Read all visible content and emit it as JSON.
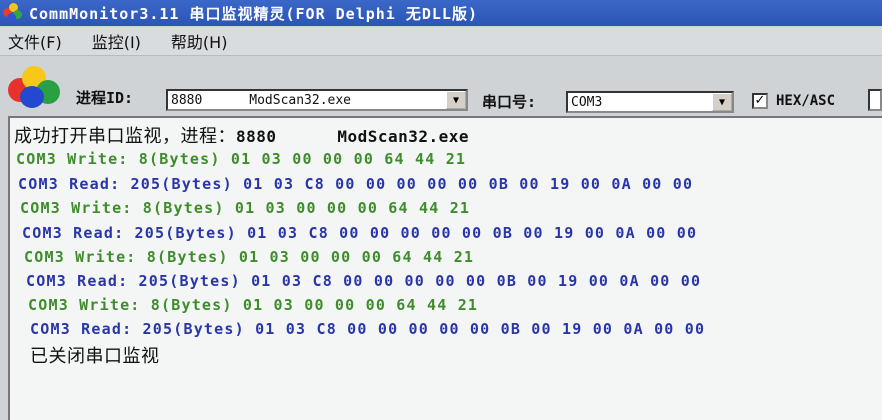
{
  "window": {
    "title": "CommMonitor3.11 串口监视精灵(FOR Delphi 无DLL版)"
  },
  "menu": [
    {
      "label": "文件(F)"
    },
    {
      "label": "监控(I)"
    },
    {
      "label": "帮助(H)"
    }
  ],
  "toolbar": {
    "process_label": "进程ID:",
    "process_value": "8880      ModScan32.exe",
    "port_label": "串口号:",
    "port_value": "COM3",
    "hex_label": "HEX/ASC",
    "hex_checked": "✓"
  },
  "log": {
    "status_open": "成功打开串口监视，进程：",
    "status_open_pid": "8880      ModScan32.exe",
    "lines": [
      {
        "kind": "write",
        "text": "COM3 Write: 8(Bytes) 01 03 00 00 00 64 44 21"
      },
      {
        "kind": "read",
        "text": "COM3 Read: 205(Bytes) 01 03 C8 00 00 00 00 00 0B 00 19 00 0A 00 00"
      },
      {
        "kind": "write",
        "text": "COM3 Write: 8(Bytes) 01 03 00 00 00 64 44 21"
      },
      {
        "kind": "read",
        "text": "COM3 Read: 205(Bytes) 01 03 C8 00 00 00 00 00 0B 00 19 00 0A 00 00"
      },
      {
        "kind": "write",
        "text": "COM3 Write: 8(Bytes) 01 03 00 00 00 64 44 21"
      },
      {
        "kind": "read",
        "text": "COM3 Read: 205(Bytes) 01 03 C8 00 00 00 00 00 0B 00 19 00 0A 00 00"
      },
      {
        "kind": "write",
        "text": "COM3 Write: 8(Bytes) 01 03 00 00 00 64 44 21"
      },
      {
        "kind": "read",
        "text": "COM3 Read: 205(Bytes) 01 03 C8 00 00 00 00 00 0B 00 19 00 0A 00 00"
      }
    ],
    "status_close": "已关闭串口监视"
  },
  "icons": {
    "app": "app-balls-icon",
    "logo": "colored-balls-logo-icon",
    "dropdown": "chevron-down-icon"
  },
  "colors": {
    "write": "#3f8c2c",
    "read": "#2a36a8",
    "titlebar": "#2c55b4"
  }
}
